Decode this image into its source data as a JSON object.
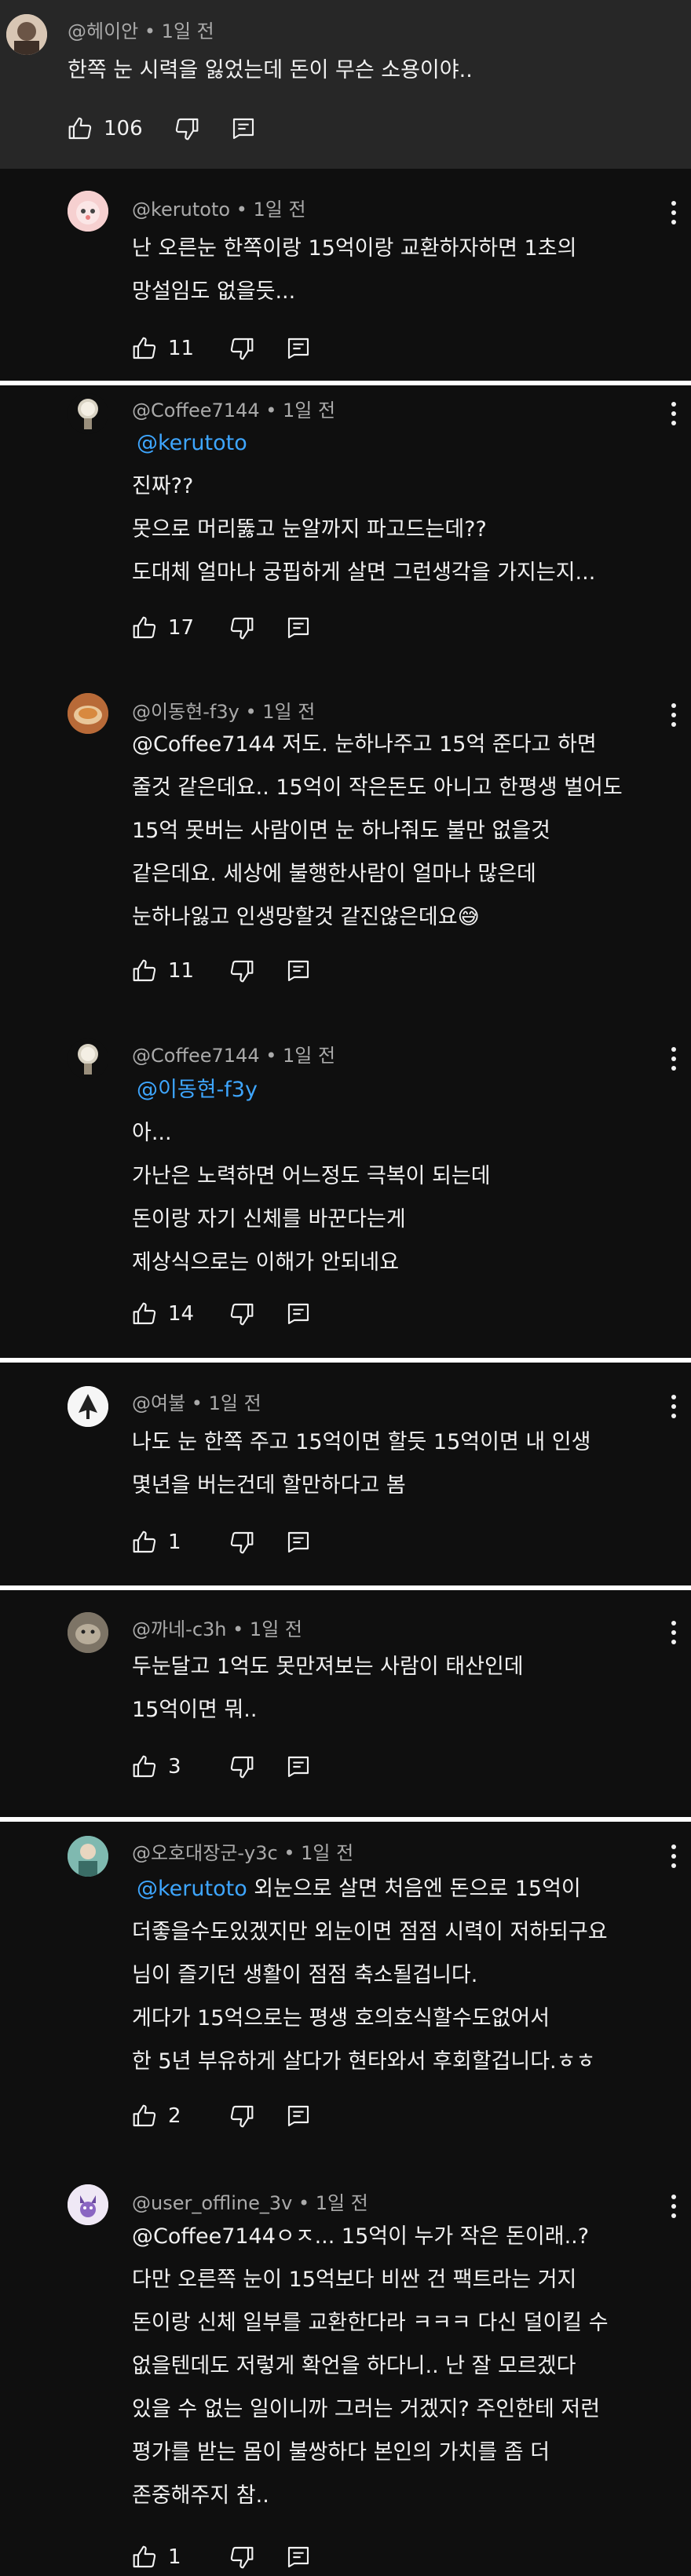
{
  "top_comment": {
    "author": "@헤이안",
    "time": "1일 전",
    "lines": [
      "한쪽 눈 시력을 잃었는데 돈이 무슨 소용이야.."
    ],
    "likes": "106"
  },
  "replies": [
    {
      "author": "@kerutoto",
      "time": "1일 전",
      "lines": [
        "난 오른눈 한쪽이랑 15억이랑 교환하자하면 1초의",
        "망설임도 없을듯..."
      ],
      "likes": "11"
    },
    {
      "author": "@Coffee7144",
      "time": "1일 전",
      "mention": "@kerutoto",
      "lines": [
        "진짜??",
        "못으로 머리뚫고 눈알까지 파고드는데??",
        "도대체 얼마나 궁핍하게 살면 그런생각을 가지는지..."
      ],
      "likes": "17"
    },
    {
      "author": "@이동현-f3y",
      "time": "1일 전",
      "lines": [
        "@Coffee7144 저도. 눈하나주고 15억 준다고 하면",
        "줄것 같은데요.. 15억이 작은돈도 아니고 한평생 벌어도",
        "15억 못버는 사람이면 눈 하나줘도 불만 없을것",
        "같은데요. 세상에 불행한사람이 얼마나 많은데",
        "눈하나잃고 인생망할것 같진않은데요😅"
      ],
      "likes": "11"
    },
    {
      "author": "@Coffee7144",
      "time": "1일 전",
      "mention": "@이동현-f3y",
      "lines": [
        "아...",
        "가난은 노력하면 어느정도 극복이 되는데",
        "돈이랑 자기 신체를 바꾼다는게",
        "제상식으로는 이해가 안되네요"
      ],
      "likes": "14"
    },
    {
      "author": "@여불",
      "time": "1일 전",
      "lines": [
        "나도 눈 한쪽 주고 15억이면 할듯 15억이면 내 인생",
        "몇년을 버는건데 할만하다고 봄"
      ],
      "likes": "1"
    },
    {
      "author": "@까네-c3h",
      "time": "1일 전",
      "lines": [
        "두눈달고 1억도 못만져보는 사람이 태산인데",
        "15억이면 뭐.."
      ],
      "likes": "3"
    },
    {
      "author": "@오호대장군-y3c",
      "time": "1일 전",
      "mention": "@kerutoto",
      "first_line_rest": " 외눈으로 살면 처음엔 돈으로 15억이",
      "lines": [
        "더좋을수도있겠지만 외눈이면 점점 시력이 저하되구요",
        "님이 즐기던 생활이 점점 축소될겁니다.",
        "게다가 15억으로는 평생 호의호식할수도없어서",
        "한 5년 부유하게 살다가 현타와서 후회할겁니다.ㅎㅎ"
      ],
      "likes": "2"
    },
    {
      "author": "@user_offline_3v",
      "time": "1일 전",
      "lines": [
        "@Coffee7144ㅇㅈ... 15억이 누가 작은 돈이래..?",
        "다만 오른쪽 눈이 15억보다 비싼 건 팩트라는 거지",
        "돈이랑 신체 일부를 교환한다라 ㅋㅋㅋ 다신 덜이킬 수",
        "없을텐데도 저렇게 확언을 하다니.. 난 잘 모르겠다",
        "있을 수 없는 일이니까 그러는 거겠지? 주인한테 저런",
        "평가를 받는 몸이 불쌍하다 본인의 가치를 좀 더",
        "존중해주지 참.."
      ],
      "likes": "1"
    }
  ]
}
